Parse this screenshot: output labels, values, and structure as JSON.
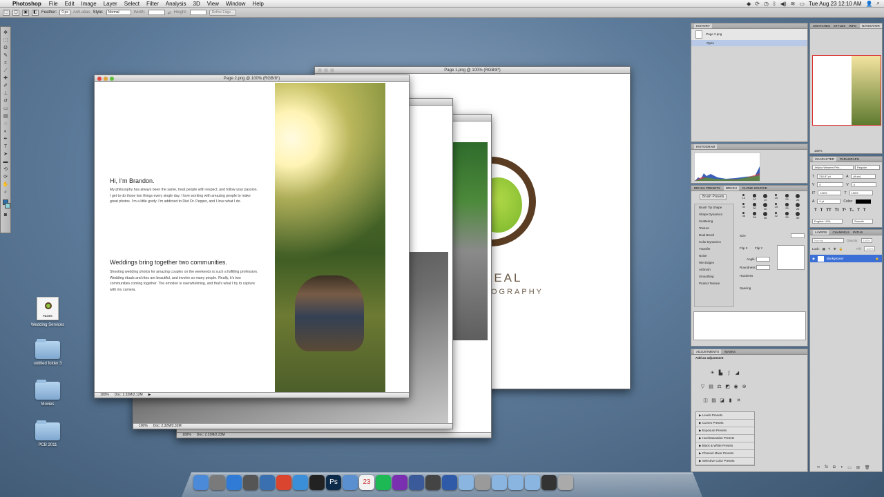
{
  "menubar": {
    "app_name": "Photoshop",
    "menus": [
      "File",
      "Edit",
      "Image",
      "Layer",
      "Select",
      "Filter",
      "Analysis",
      "3D",
      "View",
      "Window",
      "Help"
    ],
    "clock": "Tue Aug 23  12:10 AM"
  },
  "options": {
    "feather_label": "Feather:",
    "feather_value": "0 px",
    "antialias_label": "Anti-alias",
    "style_label": "Style:",
    "style_value": "Normal",
    "width_label": "Width:",
    "height_label": "Height:",
    "refine_edge_label": "Refine Edge..."
  },
  "windows": {
    "page1": {
      "title": "Page 1.png @ 100% (RGB/8*)",
      "brand_line1": "D’NEAL",
      "brand_line2": "OGRAPHY"
    },
    "page2": {
      "title": "Page 2.png @ 100% (RGB/8*)",
      "zoom": "100%",
      "doc_size": "Doc: 2.32M/2.12M",
      "heading1": "Hi, I’m Brandon.",
      "body1": "My philosophy has always been the same, treat people with respect, and follow your passion. I get to do those two things every single day. I love working with amazing people to make great photos. I’m a little goofy. I’m addicted to Diet Dr. Pepper, and I love what I do.",
      "heading2": "Weddings bring together two communities.",
      "body2": "Shooting wedding photos for amazing couples on the weekends is such a fulfilling profession. Wedding rituals and rites are beautiful, and involve so many people. Really, it’s two communities coming together. The emotion is overwhelming, and that’s what I try to capture with my camera."
    },
    "back1": {
      "zoom": "100%",
      "doc_size": "Doc: 2.32M/2.32M"
    },
    "back2": {
      "zoom": "100%",
      "doc_size": "Doc: 2.31M/2.23M"
    }
  },
  "desktop": {
    "icons": [
      {
        "label": "Wedding Services",
        "type": "pages",
        "tag": "PAGES"
      },
      {
        "label": "untitled folder 3",
        "type": "folder"
      },
      {
        "label": "Movies",
        "type": "folder"
      },
      {
        "label": "PCB 2011",
        "type": "folder"
      }
    ]
  },
  "panels": {
    "history": {
      "tab": "HISTORY",
      "snapshot": "Page 2.png",
      "items": [
        "Open"
      ]
    },
    "navigator": {
      "tabs": [
        "SWATCHES",
        "STYLES",
        "INFO",
        "NAVIGATOR"
      ],
      "zoom": "100%"
    },
    "histogram": {
      "tab": "HISTOGRAM"
    },
    "brush": {
      "tabs": [
        "BRUSH PRESETS",
        "BRUSH",
        "CLONE SOURCE"
      ],
      "presets_button": "Brush Presets",
      "options": [
        "Brush Tip Shape",
        "Shape Dynamics",
        "Scattering",
        "Texture",
        "Dual Brush",
        "Color Dynamics",
        "Transfer",
        "Noise",
        "Wet Edges",
        "Airbrush",
        "Smoothing",
        "Protect Texture"
      ],
      "size_label": "Size",
      "flip_x": "Flip X",
      "flip_y": "Flip Y",
      "angle_label": "Angle:",
      "roundness_label": "Roundness:",
      "hardness_label": "Hardness",
      "spacing_label": "Spacing",
      "sizes": [
        "10",
        "10",
        "10",
        "25",
        "25",
        "25",
        "30",
        "30",
        "30",
        "25",
        "25",
        "25",
        "36",
        "36",
        "36",
        "32",
        "25",
        "50"
      ]
    },
    "character": {
      "tabs": [
        "CHARACTER",
        "PARAGRAPH"
      ],
      "font_family": "Jellyka Western Prin...",
      "font_style": "Regular",
      "size": "218.87 pt",
      "leading": "(Auto)",
      "kerning": "0",
      "tracking": "0",
      "vscale": "100%",
      "hscale": "100%",
      "baseline": "0 pt",
      "color_label": "Color:",
      "language": "English: USA",
      "aa": "Smooth"
    },
    "layers": {
      "tabs": [
        "LAYERS",
        "CHANNELS",
        "PATHS"
      ],
      "blend": "Normal",
      "opacity_label": "Opacity:",
      "opacity": "100%",
      "lock_label": "Lock:",
      "fill_label": "Fill:",
      "fill": "100%",
      "layer_name": "Background"
    },
    "adjustments": {
      "tabs": [
        "ADJUSTMENTS",
        "MASKS"
      ],
      "add_label": "Add an adjustment",
      "presets": [
        "Levels Presets",
        "Curves Presets",
        "Exposure Presets",
        "Hue/Saturation Presets",
        "Black & White Presets",
        "Channel Mixer Presets",
        "Selective Color Presets"
      ]
    }
  },
  "dock": {
    "icons": [
      "finder-icon",
      "launchpad-icon",
      "app-store-icon",
      "facetime-icon",
      "preview-icon",
      "chrome-icon",
      "safari-icon",
      "camera-icon",
      "photoshop-icon",
      "script-icon",
      "calendar-icon",
      "spotify-icon",
      "itunes-icon",
      "xcode-icon",
      "imovie-icon",
      "keynote-icon",
      "folder-icon",
      "help-icon",
      "folder-icon",
      "folder-icon",
      "folder-icon",
      "camera-icon",
      "trash-icon"
    ],
    "ps_label": "Ps",
    "cal_label": "23"
  }
}
